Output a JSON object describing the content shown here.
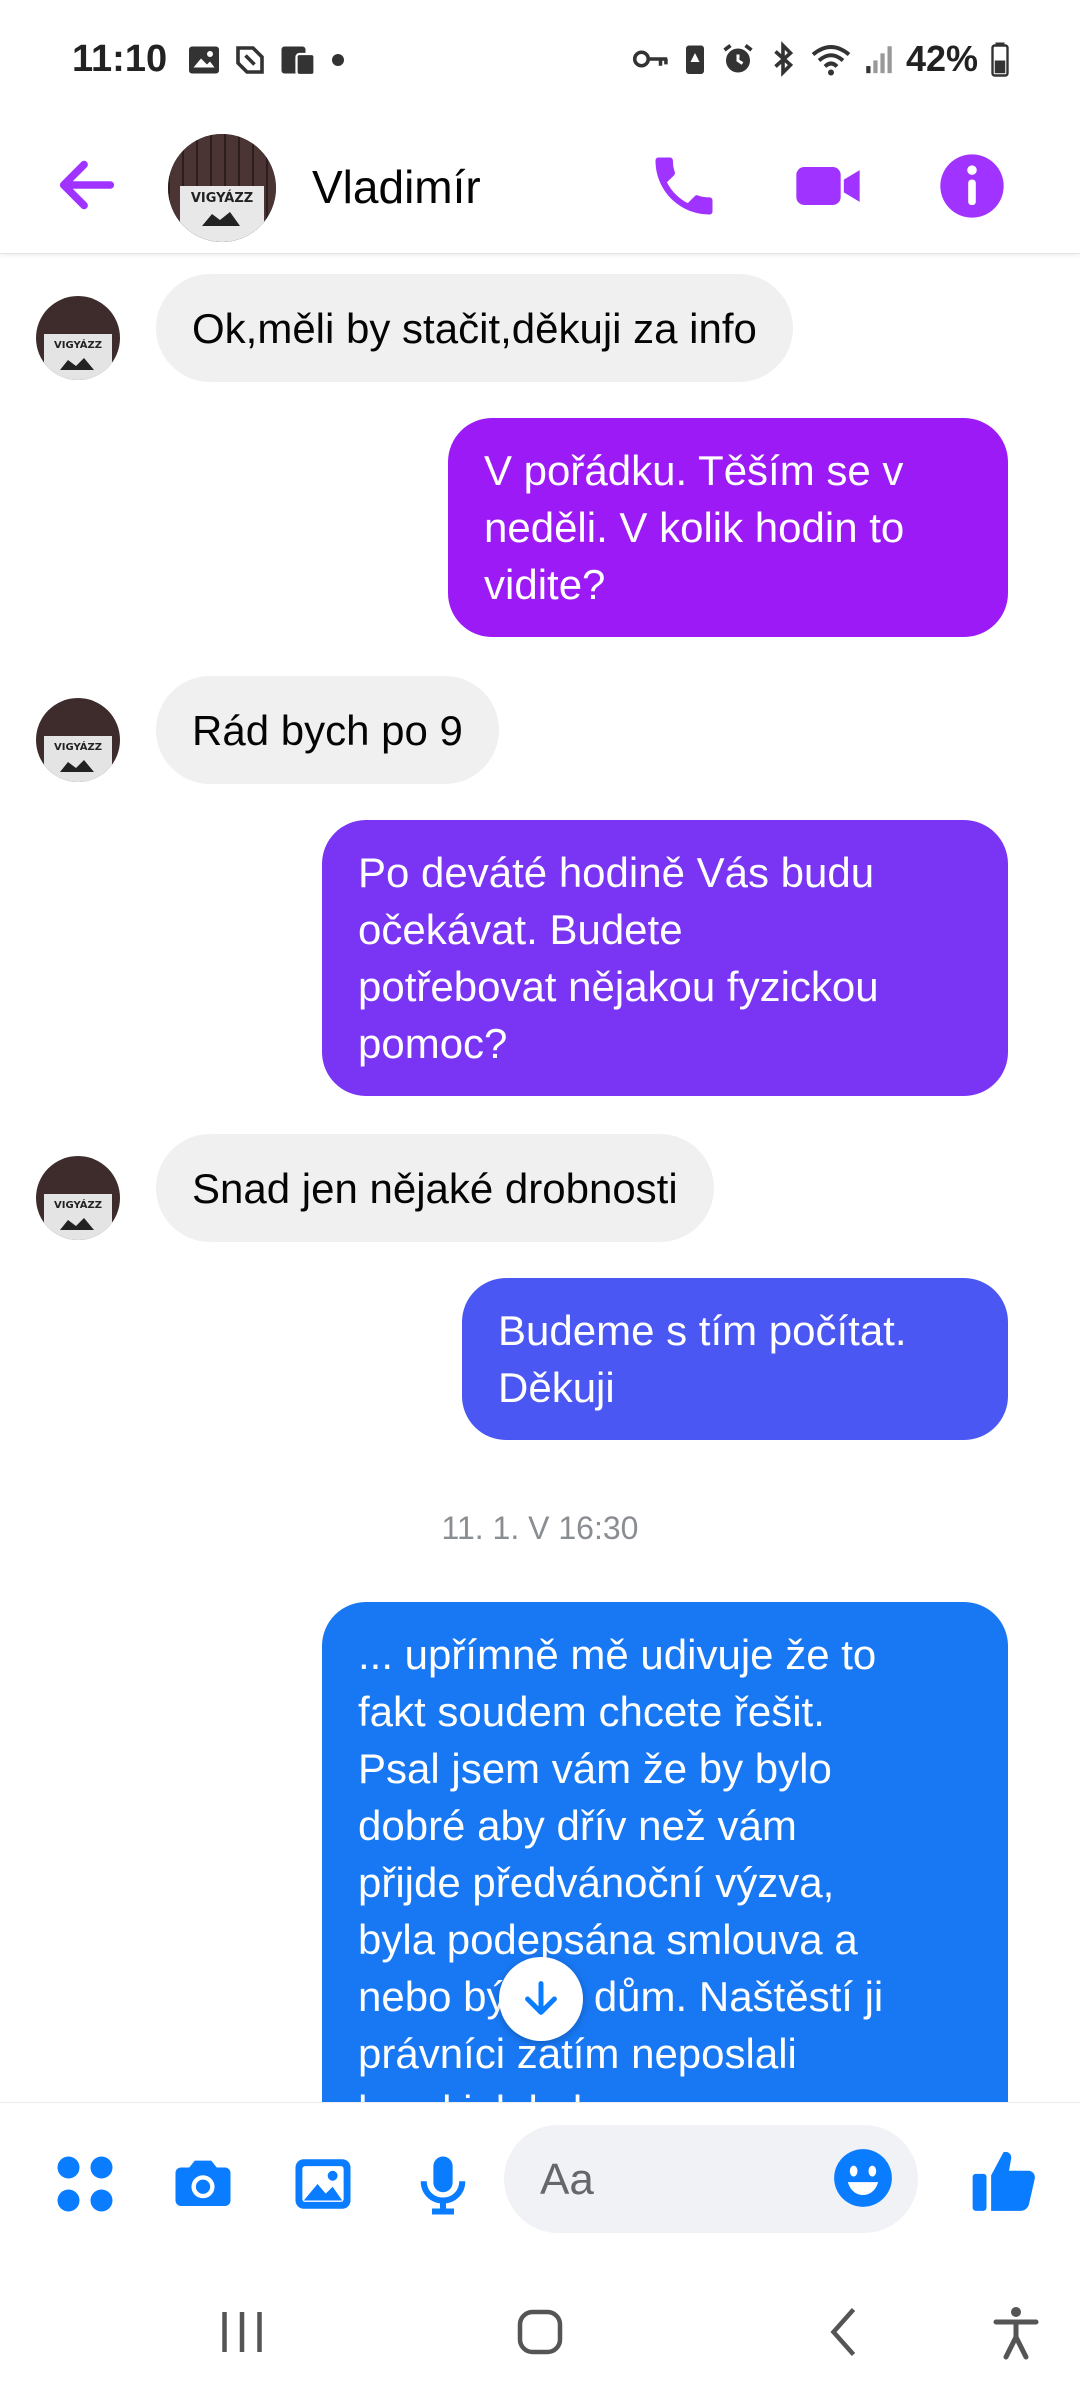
{
  "status_bar": {
    "time": "11:10",
    "battery": "42%",
    "icons_left": [
      "image-icon",
      "nfc-icon",
      "clipboard-icon",
      "dot-icon"
    ],
    "icons_right": [
      "key-icon",
      "battery-saver-icon",
      "alarm-icon",
      "bluetooth-icon",
      "wifi-icon",
      "signal-icon",
      "battery-icon"
    ]
  },
  "header": {
    "contact_name": "Vladimír",
    "avatar_text": "VIGYÁZZ"
  },
  "messages": [
    {
      "direction": "incoming",
      "text": "Ok,měli by stačit,děkuji za info"
    },
    {
      "direction": "outgoing",
      "lines": [
        "V pořádku. Těším se v",
        "neděli. V kolik hodin to",
        "vidite?"
      ],
      "color": "#9b1af5"
    },
    {
      "direction": "incoming",
      "text": "Rád bych po 9"
    },
    {
      "direction": "outgoing",
      "lines": [
        "Po deváté hodině Vás budu",
        "očekávat. Budete",
        "potřebovat nějakou fyzickou",
        "pomoc?"
      ],
      "color": "#7a34f3"
    },
    {
      "direction": "incoming",
      "text": "Snad jen nějaké drobnosti"
    },
    {
      "direction": "outgoing",
      "lines": [
        "Budeme s tím počítat.",
        "Děkuji"
      ],
      "color": "#4a57f2"
    },
    {
      "direction": "timestamp",
      "text": "11. 1. V 16:30"
    },
    {
      "direction": "outgoing",
      "lines": [
        "... upřímně mě udivuje že to",
        "fakt soudem chcete řešit.",
        "Psal jsem vám že by bylo",
        "dobré aby dřív než vám",
        "přijde předvánoční výzva,",
        "byla podepsána smlouva a",
        "nebo bývalý dům. Naštěstí ji",
        "právníci zatím neposlali",
        "hned jak bylo ..."
      ],
      "color": "#1877f2"
    }
  ],
  "composer": {
    "placeholder": "Aa",
    "icons": [
      "apps-icon",
      "camera-icon",
      "gallery-icon",
      "microphone-icon",
      "emoji-icon",
      "thumbs-up-icon"
    ]
  },
  "colors": {
    "accent": "#a033ff",
    "composer_blue": "#0a7cff",
    "incoming_bg": "#f0f0f0"
  }
}
